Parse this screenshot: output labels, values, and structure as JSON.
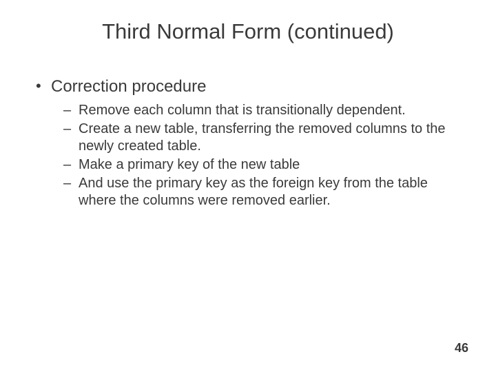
{
  "title": "Third Normal Form (continued)",
  "bullet": {
    "label": "Correction procedure",
    "sub": [
      "Remove each column that is transitionally dependent.",
      "Create a new table,  transferring the removed columns to the newly created table.",
      "Make a primary key of the new table",
      "And use the primary key as the foreign key from the table where the columns were removed earlier."
    ]
  },
  "page_number": "46"
}
